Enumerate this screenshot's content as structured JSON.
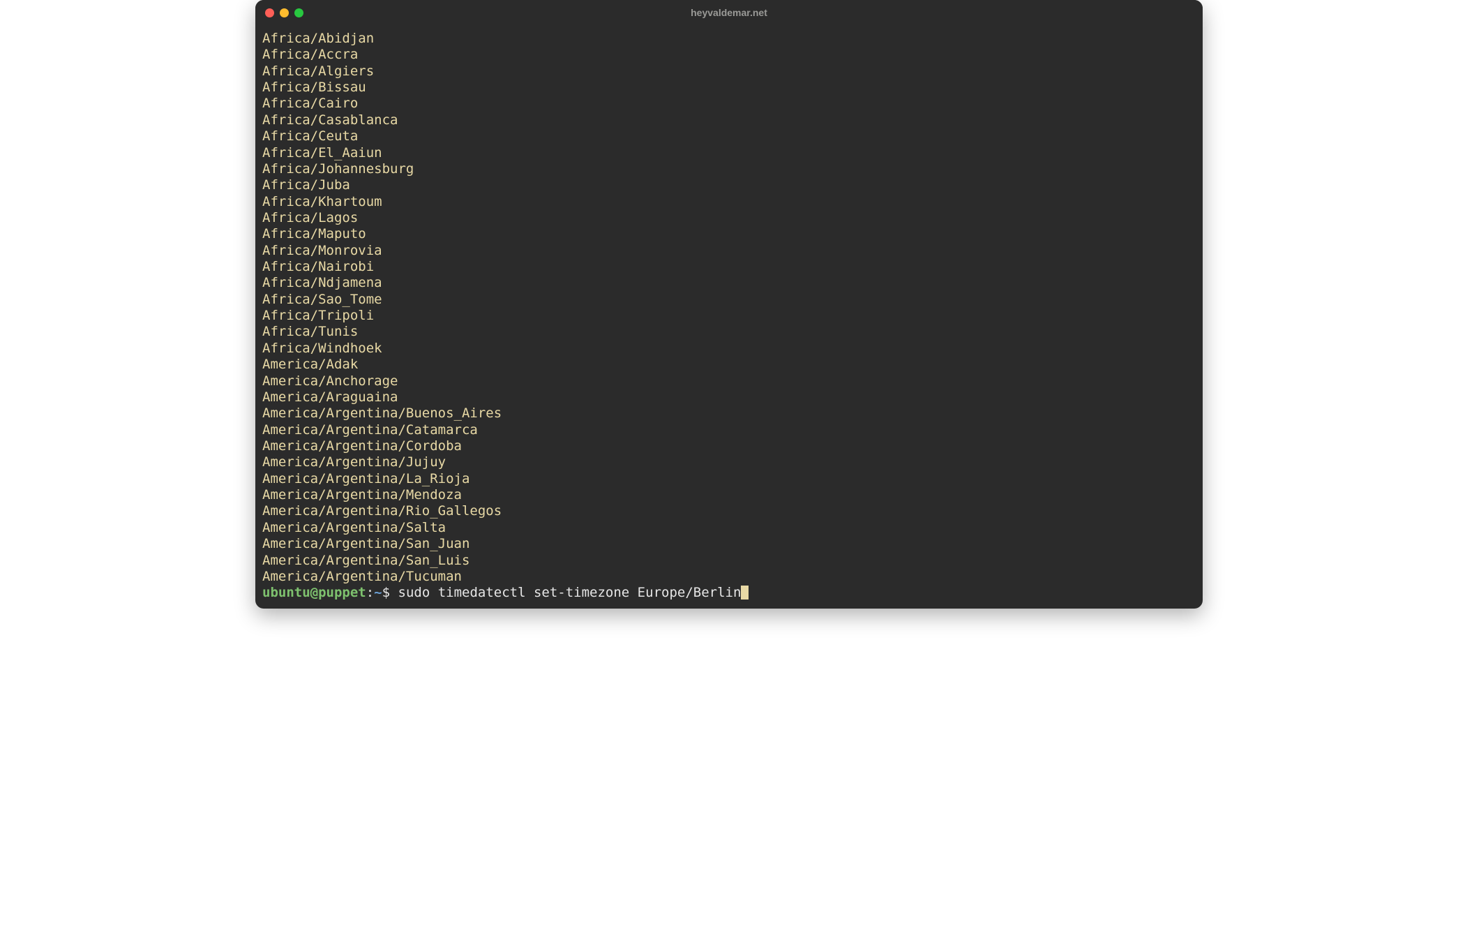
{
  "window": {
    "title": "heyvaldemar.net"
  },
  "output_lines": [
    "Africa/Abidjan",
    "Africa/Accra",
    "Africa/Algiers",
    "Africa/Bissau",
    "Africa/Cairo",
    "Africa/Casablanca",
    "Africa/Ceuta",
    "Africa/El_Aaiun",
    "Africa/Johannesburg",
    "Africa/Juba",
    "Africa/Khartoum",
    "Africa/Lagos",
    "Africa/Maputo",
    "Africa/Monrovia",
    "Africa/Nairobi",
    "Africa/Ndjamena",
    "Africa/Sao_Tome",
    "Africa/Tripoli",
    "Africa/Tunis",
    "Africa/Windhoek",
    "America/Adak",
    "America/Anchorage",
    "America/Araguaina",
    "America/Argentina/Buenos_Aires",
    "America/Argentina/Catamarca",
    "America/Argentina/Cordoba",
    "America/Argentina/Jujuy",
    "America/Argentina/La_Rioja",
    "America/Argentina/Mendoza",
    "America/Argentina/Rio_Gallegos",
    "America/Argentina/Salta",
    "America/Argentina/San_Juan",
    "America/Argentina/San_Luis",
    "America/Argentina/Tucuman"
  ],
  "prompt": {
    "user_host": "ubuntu@puppet",
    "colon": ":",
    "path": "~",
    "dollar": "$ ",
    "command": "sudo timedatectl set-timezone Europe/Berlin"
  }
}
